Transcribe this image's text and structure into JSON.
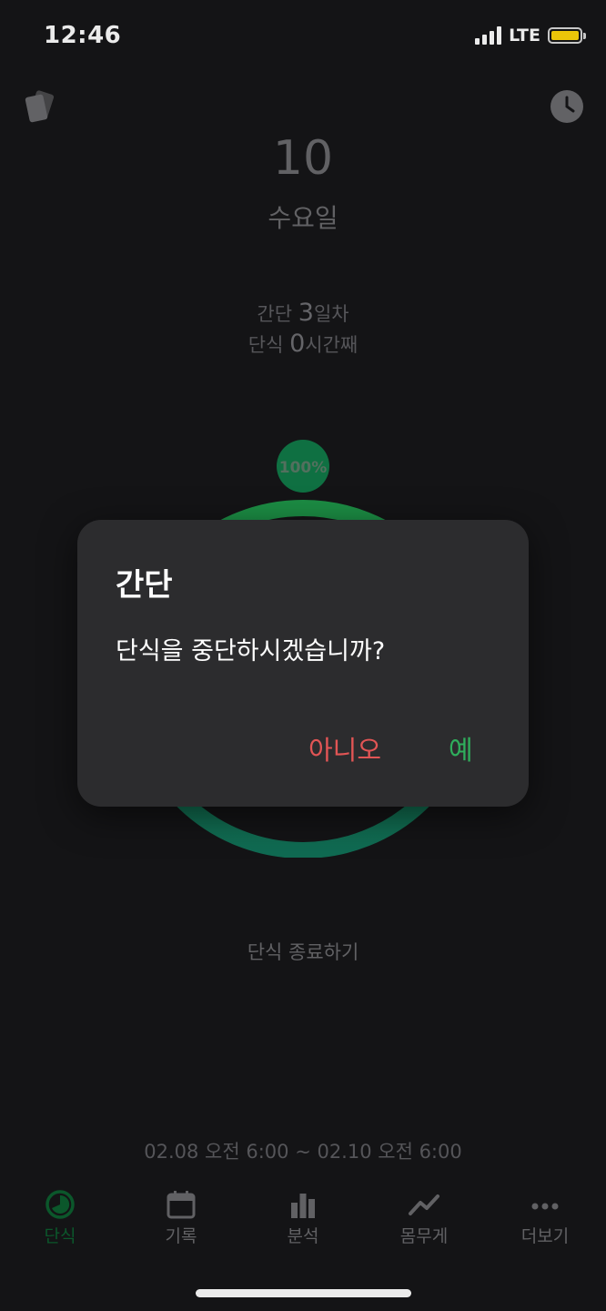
{
  "status_bar": {
    "time": "12:46",
    "network": "LTE"
  },
  "header": {
    "day": "10",
    "weekday": "수요일"
  },
  "stats": {
    "line1_prefix": "간단 ",
    "line1_value": "3",
    "line1_suffix": "일차",
    "line2_prefix": "단식 ",
    "line2_value": "0",
    "line2_suffix": "시간째"
  },
  "progress": {
    "label": "100%",
    "fraction": 1.0,
    "color_start": "#1f9a4a",
    "color_end": "#12745a"
  },
  "end_button_label": "단식 종료하기",
  "date_range": "02.08 오전 6:00 ~ 02.10 오전 6:00",
  "tabs": [
    {
      "label": "단식",
      "icon": "timer-icon"
    },
    {
      "label": "기록",
      "icon": "calendar-icon"
    },
    {
      "label": "분석",
      "icon": "bar-chart-icon"
    },
    {
      "label": "몸무게",
      "icon": "trend-line-icon"
    },
    {
      "label": "더보기",
      "icon": "more-dots-icon"
    }
  ],
  "dialog": {
    "title": "간단",
    "message": "단식을 중단하시겠습니까?",
    "no_label": "아니오",
    "yes_label": "예"
  },
  "colors": {
    "background": "#161618",
    "dialog": "#2c2c2e",
    "accent_green": "#2fae5c",
    "danger_red": "#e25555",
    "battery": "#ffd60a"
  }
}
